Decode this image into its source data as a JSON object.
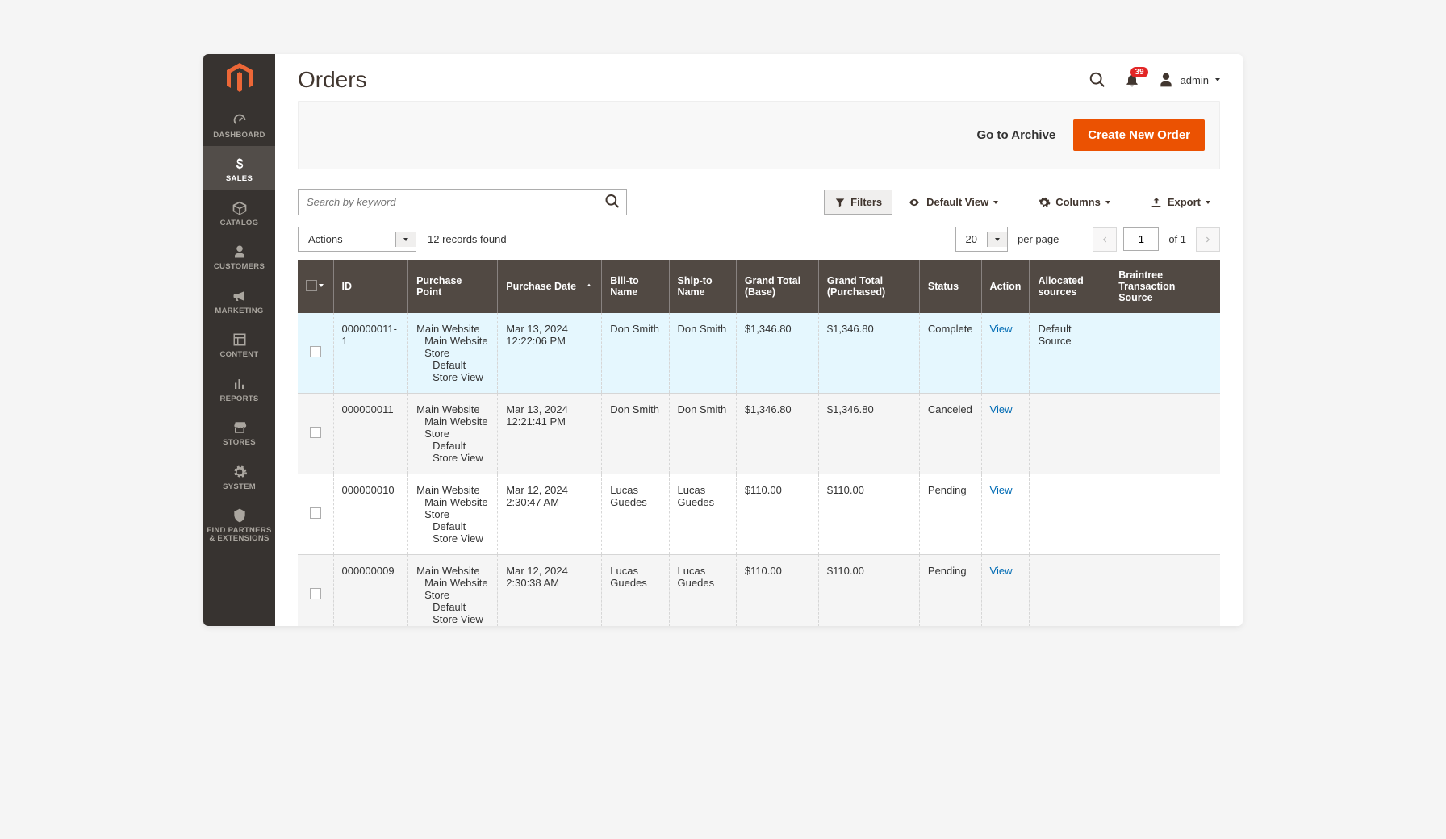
{
  "page_title": "Orders",
  "notification_count": "39",
  "user_name": "admin",
  "sidebar": {
    "items": [
      {
        "label": "DASHBOARD"
      },
      {
        "label": "SALES"
      },
      {
        "label": "CATALOG"
      },
      {
        "label": "CUSTOMERS"
      },
      {
        "label": "MARKETING"
      },
      {
        "label": "CONTENT"
      },
      {
        "label": "REPORTS"
      },
      {
        "label": "STORES"
      },
      {
        "label": "SYSTEM"
      },
      {
        "label": "FIND PARTNERS & EXTENSIONS"
      }
    ]
  },
  "actionbar": {
    "archive_link": "Go to Archive",
    "create_button": "Create New Order"
  },
  "search": {
    "placeholder": "Search by keyword"
  },
  "toolbar": {
    "filters": "Filters",
    "default_view": "Default View",
    "columns": "Columns",
    "export": "Export"
  },
  "bulk_actions": {
    "label": "Actions"
  },
  "records_found": "12 records found",
  "pagination": {
    "per_page_value": "20",
    "per_page_label": "per page",
    "current_page": "1",
    "of_label": "of 1"
  },
  "columns": {
    "id": "ID",
    "purchase_point": "Purchase Point",
    "purchase_date": "Purchase Date",
    "bill_to": "Bill-to Name",
    "ship_to": "Ship-to Name",
    "gt_base": "Grand Total (Base)",
    "gt_purchased": "Grand Total (Purchased)",
    "status": "Status",
    "action": "Action",
    "allocated": "Allocated sources",
    "braintree": "Braintree Transaction Source"
  },
  "purchase_point": {
    "l1": "Main Website",
    "l2": "Main Website Store",
    "l3": "Default Store View"
  },
  "action_label": "View",
  "rows": [
    {
      "id": "000000011-1",
      "date": "Mar 13, 2024 12:22:06 PM",
      "bill": "Don Smith",
      "ship": "Don Smith",
      "gtb": "$1,346.80",
      "gtp": "$1,346.80",
      "status": "Complete",
      "allocated": "Default Source",
      "bt": ""
    },
    {
      "id": "000000011",
      "date": "Mar 13, 2024 12:21:41 PM",
      "bill": "Don Smith",
      "ship": "Don Smith",
      "gtb": "$1,346.80",
      "gtp": "$1,346.80",
      "status": "Canceled",
      "allocated": "",
      "bt": ""
    },
    {
      "id": "000000010",
      "date": "Mar 12, 2024 2:30:47 AM",
      "bill": "Lucas Guedes",
      "ship": "Lucas Guedes",
      "gtb": "$110.00",
      "gtp": "$110.00",
      "status": "Pending",
      "allocated": "",
      "bt": ""
    },
    {
      "id": "000000009",
      "date": "Mar 12, 2024 2:30:38 AM",
      "bill": "Lucas Guedes",
      "ship": "Lucas Guedes",
      "gtb": "$110.00",
      "gtp": "$110.00",
      "status": "Pending",
      "allocated": "",
      "bt": ""
    }
  ]
}
